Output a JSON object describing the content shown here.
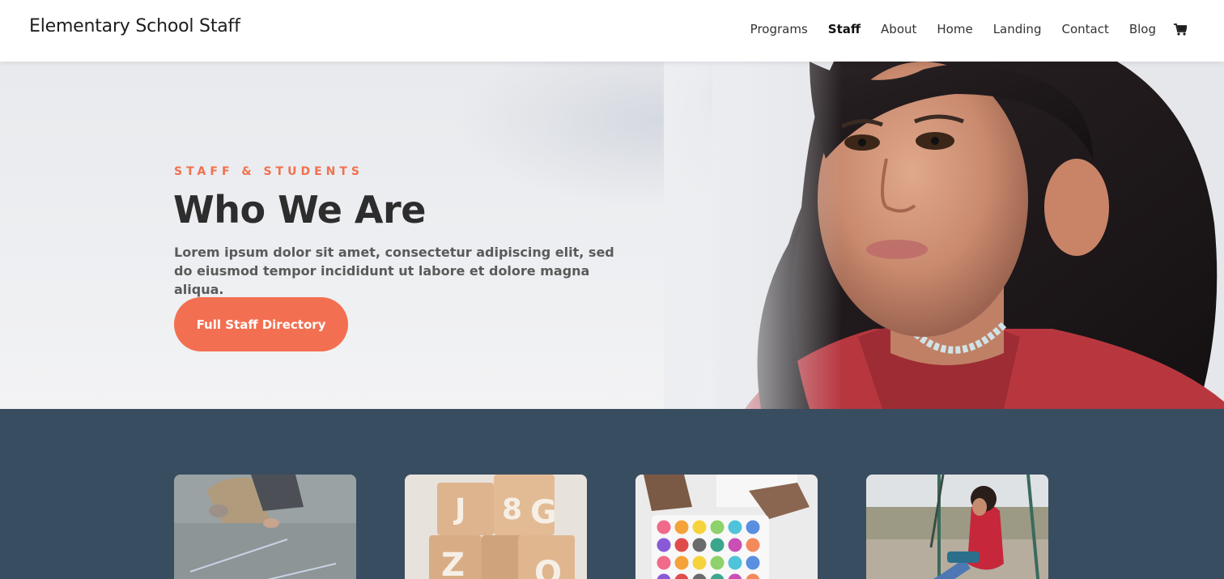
{
  "header": {
    "brand": "Elementary School Staff",
    "nav": [
      {
        "label": "Programs",
        "active": false
      },
      {
        "label": "Staff",
        "active": true
      },
      {
        "label": "About",
        "active": false
      },
      {
        "label": "Home",
        "active": false
      },
      {
        "label": "Landing",
        "active": false
      },
      {
        "label": "Contact",
        "active": false
      },
      {
        "label": "Blog",
        "active": false
      }
    ],
    "cart_icon": "cart-icon"
  },
  "hero": {
    "eyebrow": "STAFF & STUDENTS",
    "title": "Who We Are",
    "text": "Lorem ipsum dolor sit amet, consectetur adipiscing elit, sed do eiusmod tempor incididunt ut labore et dolore magna aliqua.",
    "cta_label": "Full Staff Directory",
    "image": "girl-portrait-photo"
  },
  "gallery": {
    "cards": [
      {
        "image": "child-chalk-drawing-photo"
      },
      {
        "image": "wooden-letter-blocks-photo"
      },
      {
        "image": "watercolor-paint-palette-photo"
      },
      {
        "image": "girl-on-swing-photo"
      }
    ]
  },
  "colors": {
    "accent": "#f36f51",
    "dark_section": "#394d61",
    "heading": "#2d2d2d"
  }
}
